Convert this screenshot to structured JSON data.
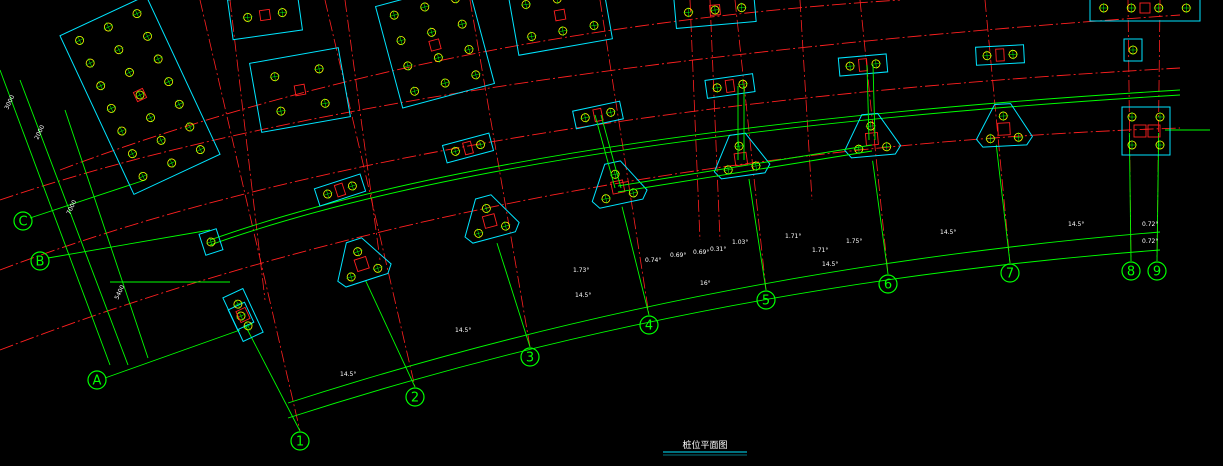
{
  "drawing": {
    "title": "桩位平面图",
    "colors": {
      "background": "#000000",
      "axis_line": "#ff2020",
      "grid_line": "#00ff00",
      "cap_outline": "#00e5ff",
      "pile_circle": "#ffff00",
      "beam_line": "#00ff00",
      "column": "#ff2020",
      "dimension_text": "#ffffff"
    },
    "column_axes": [
      "1",
      "2",
      "3",
      "4",
      "5",
      "6",
      "7",
      "8",
      "9"
    ],
    "row_axes": [
      "A",
      "B",
      "C"
    ],
    "angle_labels": [
      "14.5°",
      "14.5°",
      "14.5°",
      "16°",
      "14.5°",
      "14.5°",
      "14.5°",
      "0.72°",
      "0.72°"
    ],
    "sub_angles": [
      "1.73°",
      "0.74°",
      "0.69°",
      "0.69°",
      "0.31°",
      "1.03°",
      "1.71°",
      "1.71°",
      "1.75°"
    ],
    "row_dimensions": [
      "3000",
      "2000",
      "5400",
      "7000"
    ]
  }
}
